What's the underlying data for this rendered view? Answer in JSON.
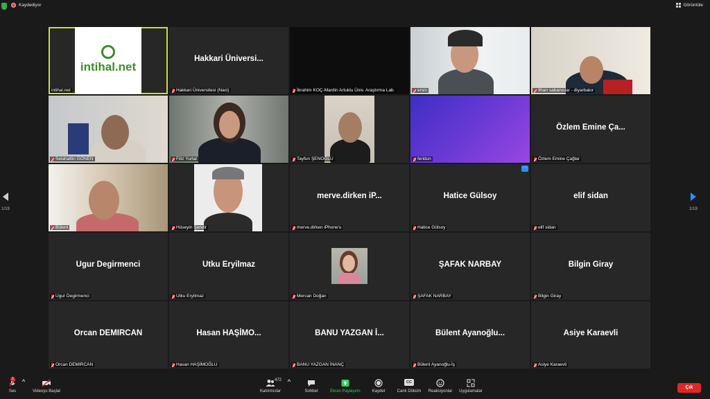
{
  "topbar": {
    "recording_label": "Kaydediyor",
    "view_label": "Görüntüle"
  },
  "pager": {
    "left_label": "1/19",
    "right_label": "1/19"
  },
  "tiles": [
    {
      "kind": "logo",
      "logo_text": "intihal.net",
      "caption": "intihal.net",
      "muted": false,
      "active": true
    },
    {
      "kind": "name",
      "big": "Hakkari  Üniversi...",
      "caption": "Hakkari Üniversitesi (Naci)",
      "muted": true
    },
    {
      "kind": "dark",
      "caption": "İbrahim KOÇ-Mardin Artuklu Üniv. Araştırma Lab.",
      "muted": true
    },
    {
      "kind": "video",
      "caption": "ersin",
      "muted": true
    },
    {
      "kind": "video",
      "caption": "İlhan sabancılar - diyarbakır",
      "muted": true
    },
    {
      "kind": "video",
      "caption": "Selahattin GÖNEN",
      "muted": true
    },
    {
      "kind": "video",
      "caption": "Filiz Yurtal",
      "muted": true
    },
    {
      "kind": "video",
      "caption": "Tayfun ŞENOĞLU",
      "muted": true
    },
    {
      "kind": "purple",
      "caption": "feridun",
      "muted": true
    },
    {
      "kind": "name",
      "big": "Özlem   Emine  Ça...",
      "caption": "Özlem  Emine Çağlar",
      "muted": true
    },
    {
      "kind": "video",
      "caption": "Bülent",
      "muted": true
    },
    {
      "kind": "video",
      "caption": "Hüseyin Şendir",
      "muted": true
    },
    {
      "kind": "name",
      "big": "merve.dirken  iP...",
      "caption": "merve.dirken iPhone'u",
      "muted": true
    },
    {
      "kind": "name",
      "big": "Hatice Gülsoy",
      "caption": "Hatice Gülsoy",
      "muted": true,
      "more": "···"
    },
    {
      "kind": "name",
      "big": "elif sidan",
      "caption": "elif sidan",
      "muted": true
    },
    {
      "kind": "name",
      "big": "Ugur Degirmenci",
      "caption": "Ugur Degirmenci",
      "muted": true
    },
    {
      "kind": "name",
      "big": "Utku Eryilmaz",
      "caption": "Utku Eryilmaz",
      "muted": true
    },
    {
      "kind": "photo",
      "caption": "Mercan Doğan",
      "muted": true
    },
    {
      "kind": "name",
      "big": "ŞAFAK NARBAY",
      "caption": "ŞAFAK NARBAY",
      "muted": true
    },
    {
      "kind": "name",
      "big": "Bilgin Giray",
      "caption": "Bilgin Giray",
      "muted": true
    },
    {
      "kind": "name",
      "big": "Orcan DEMIRCAN",
      "caption": "Orcan DEMIRCAN",
      "muted": true
    },
    {
      "kind": "name",
      "big": "Hasan  HAŞİMO...",
      "caption": "Hasan HAŞİMOĞLU",
      "muted": true
    },
    {
      "kind": "name",
      "big": "BANU  YAZGAN  İ...",
      "caption": "BANU YAZGAN İNANÇ",
      "muted": true
    },
    {
      "kind": "name",
      "big": "Bülent  Ayanoğlu...",
      "caption": "Bülent Ayanoğlu-İş",
      "muted": true
    },
    {
      "kind": "name",
      "big": "Asiye Karaevli",
      "caption": "Asiye Karaevli",
      "muted": true
    }
  ],
  "toolbar": {
    "audio_label": "Ses",
    "video_label": "Videoyu Başlat",
    "participants_label": "Katılımcılar",
    "participants_count": "472",
    "chat_label": "Sohbet",
    "share_label": "Ekran Paylaşımı",
    "record_label": "Kaydet",
    "cc_label": "Canlı Döküm",
    "cc_icon_text": "CC",
    "reactions_label": "Reaksiyonlar",
    "apps_label": "Uygulamalar",
    "leave_label": "Çık",
    "audio_badge": "1"
  },
  "colors": {
    "active_border": "#c9e03a",
    "share_green": "#23d959",
    "leave_red": "#e02828",
    "accent_blue": "#2d8cff"
  }
}
